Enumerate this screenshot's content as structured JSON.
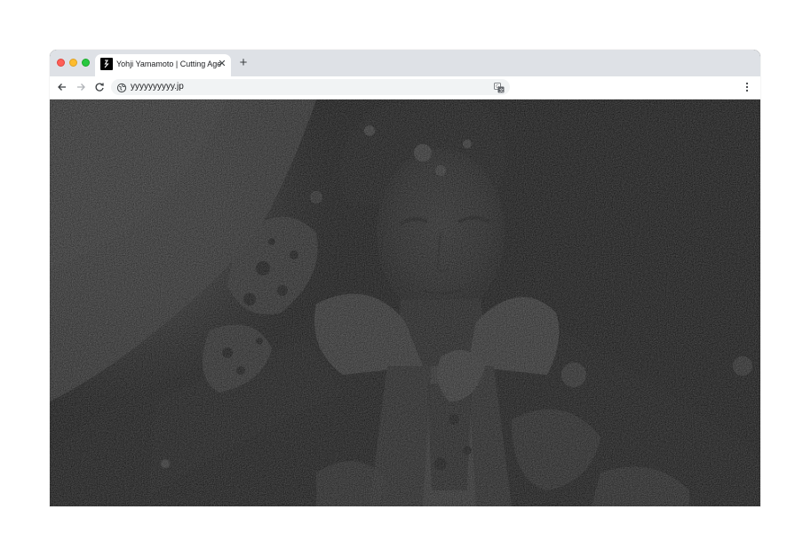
{
  "browser": {
    "tab": {
      "title": "Yohji Yamamoto | Cutting Age",
      "favicon": "yohji-logo-icon",
      "close_icon": "close-icon"
    },
    "new_tab_icon": "plus-icon",
    "toolbar": {
      "back_icon": "arrow-left-icon",
      "forward_icon": "arrow-right-icon",
      "reload_icon": "reload-icon",
      "site_icon": "globe-icon",
      "url": "yyyyyyyyyy.jp",
      "translate_icon": "translate-icon",
      "menu_icon": "more-vertical-icon"
    },
    "colors": {
      "tabstrip": "#dee1e6",
      "tab_active": "#ffffff",
      "omnibox": "#f1f3f4",
      "traffic_red": "#ff5f57",
      "traffic_yellow": "#febc2e",
      "traffic_green": "#28c840"
    }
  },
  "page": {
    "hero_image": "black-and-white distressed photograph of a young man in a dark coat and white collar"
  }
}
